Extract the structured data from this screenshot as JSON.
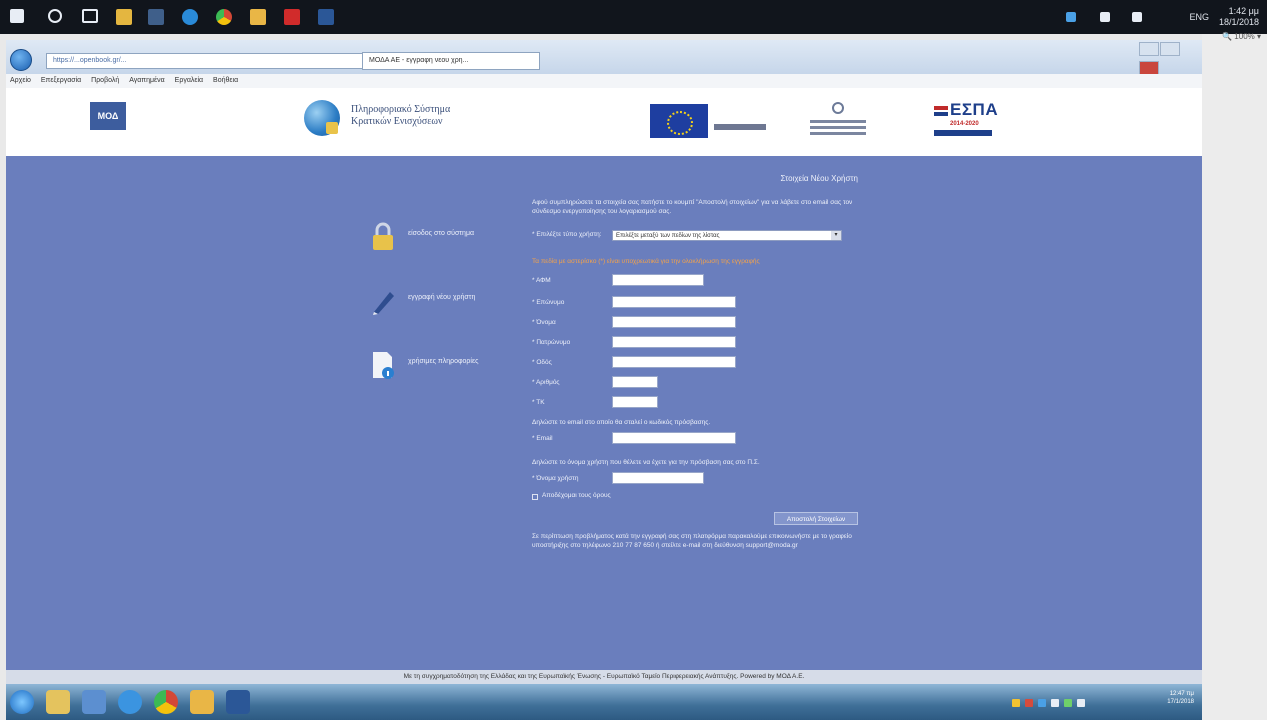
{
  "outer_taskbar": {
    "language": "ENG",
    "time": "1:42 μμ",
    "date": "18/1/2018",
    "zoom": "🔍 100% ▾"
  },
  "browser": {
    "address": "https://...openbook.gr/...",
    "tab_label": "ΜΟΔΑ ΑΕ - εγγραφη νεου χρη...",
    "menu": [
      "Αρχείο",
      "Επεξεργασία",
      "Προβολή",
      "Αγαπημένα",
      "Εργαλεία",
      "Βοήθεια"
    ]
  },
  "header": {
    "logo_text": "ΜΟΔ",
    "site_title_line1": "Πληροφοριακό Σύστημα",
    "site_title_line2": "Κρατικών Ενισχύσεων",
    "espa": "ΕΣΠΑ",
    "espa_years": "2014-2020"
  },
  "sidebar": {
    "items": [
      {
        "label": "είσοδος στο σύστημα"
      },
      {
        "label": "εγγραφή νέου χρήστη"
      },
      {
        "label": "χρήσιμες πληροφορίες"
      }
    ]
  },
  "form": {
    "title": "Στοιχεία Νέου Χρήστη",
    "intro": "Αφού συμπληρώσετε τα στοιχεία σας πατήστε το κουμπί \"Αποστολή στοιχείων\" για να λάβετε στο email σας τον σύνδεσμο ενεργοποίησης του λογαριασμού σας.",
    "user_type_label": "* Επιλέξτε τύπο χρήστη:",
    "user_type_value": "Επιλέξτε μεταξύ των πεδίων της λίστας",
    "warning": "Τα πεδία με αστερίσκο (*) είναι υποχρεωτικά για την ολοκλήρωση της εγγραφής",
    "fields": [
      {
        "label": "* ΑΦΜ"
      },
      {
        "label": "* Επώνυμο"
      },
      {
        "label": "* Όνομα"
      },
      {
        "label": "* Πατρώνυμο"
      },
      {
        "label": "* Οδός"
      },
      {
        "label": "* Αριθμός"
      },
      {
        "label": "* ΤΚ"
      }
    ],
    "email_note": "Δηλώστε το email στο οποίο θα σταλεί ο κωδικός πρόσβασης.",
    "email_label": "* Email",
    "username_note": "Δηλώστε το όνομα χρήστη που θέλετε να έχετε για την πρόσβαση σας στο Π.Σ.",
    "username_label": "* Όνομα χρήστη",
    "agree_label": "Αποδέχομαι τους όρους",
    "submit_label": "Αποστολή Στοιχείων",
    "footer_note": "Σε περίπτωση προβλήματος κατά την εγγραφή σας στη πλατφόρμα παρακαλούμε επικοινωνήστε με το γραφείο υποστήριξης στο τηλέφωνο 210 77 87 650 ή στείλτε e-mail στη διεύθυνση support@moda.gr"
  },
  "footer": {
    "text": "Με τη συγχρηματοδότηση της Ελλάδας και της Ευρωπαϊκής Ένωσης - Ευρωπαϊκό Ταμείο Περιφερειακής Ανάπτυξης. Powered by ΜΟΔ Α.Ε."
  },
  "inner_taskbar": {
    "time": "12:47 πμ",
    "date": "17/1/2018"
  },
  "colors": {
    "content_bg": "#6a7ebd",
    "warning": "#f3a24b",
    "header_bg": "#ffffff"
  }
}
